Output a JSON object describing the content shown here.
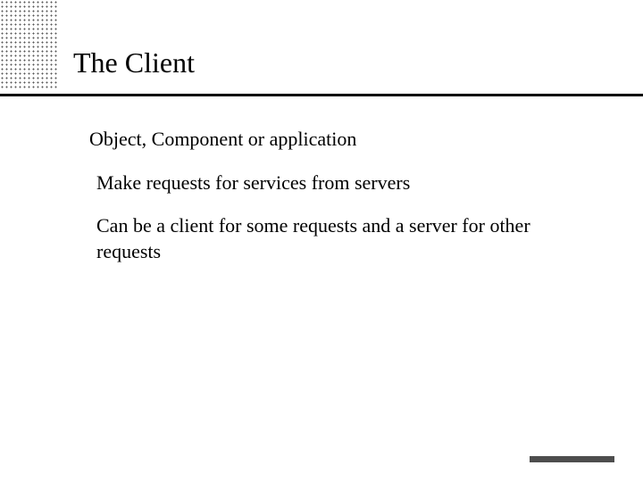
{
  "title": "The Client",
  "bullets": {
    "level1": "Object, Component or application",
    "level2a": "Make requests for services from servers",
    "level2b": "Can be a client for some requests and a server for other requests"
  }
}
